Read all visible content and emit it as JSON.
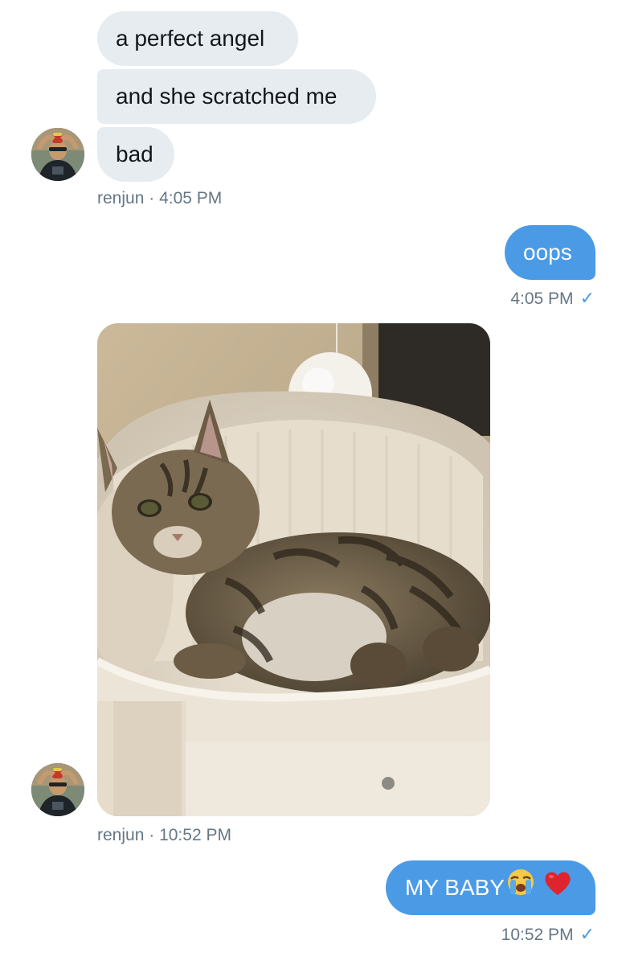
{
  "conversation": {
    "messages": [
      {
        "text": "a perfect angel",
        "direction": "incoming"
      },
      {
        "text": "and she scratched me",
        "direction": "incoming"
      },
      {
        "text": "bad",
        "direction": "incoming"
      },
      {
        "text": "oops",
        "direction": "outgoing"
      },
      {
        "text": "MY BABY",
        "direction": "outgoing"
      }
    ],
    "meta": [
      {
        "sender": "renjun",
        "separator": "·",
        "time": "4:05 PM"
      },
      {
        "time": "4:05 PM",
        "read_mark": "✓"
      },
      {
        "sender": "renjun",
        "separator": "·",
        "time": "10:52 PM"
      },
      {
        "time": "10:52 PM",
        "read_mark": "✓"
      }
    ],
    "attachment": {
      "kind": "photo",
      "subject": "tabby kitten lying in cat bed"
    }
  },
  "icons": {
    "crying": "loudly-crying-face-emoji",
    "heart": "red-heart-emoji",
    "check": "read-check-icon"
  },
  "colors": {
    "incoming_bubble": "#e6ecf0",
    "outgoing_bubble": "#4a9ae6",
    "meta_text": "#657786",
    "check": "#4a9ae6"
  }
}
